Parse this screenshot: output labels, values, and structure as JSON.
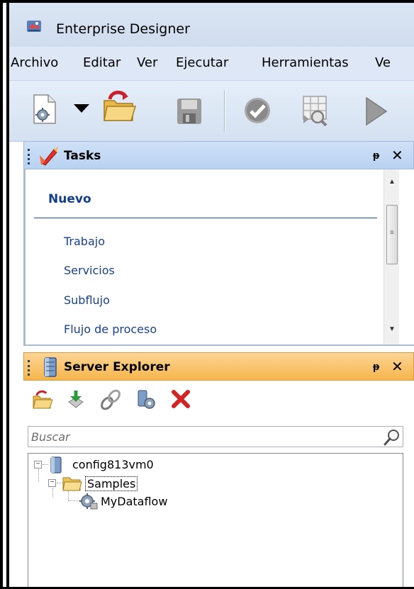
{
  "window": {
    "title": "Enterprise Designer"
  },
  "menu": {
    "items": [
      "Archivo",
      "Editar",
      "Ver",
      "Ejecutar",
      "Herramientas",
      "Ve"
    ]
  },
  "toolbar": {
    "buttons": [
      "new-icon",
      "dropdown-arrow-icon",
      "open-folder-icon",
      "save-icon",
      "validate-icon",
      "inspect-grid-icon",
      "run-icon"
    ]
  },
  "tasks": {
    "title": "Tasks",
    "pin_label": "ᵽ",
    "close_label": "✕",
    "section": "Nuevo",
    "links": [
      "Trabajo",
      "Servicios",
      "Subflujo",
      "Flujo de proceso"
    ]
  },
  "server_explorer": {
    "title": "Server Explorer",
    "pin_label": "ᵽ",
    "close_label": "✕",
    "search_placeholder": "Buscar",
    "tree": {
      "server": "config813vm0",
      "folder": "Samples",
      "item": "MyDataflow"
    }
  },
  "colors": {
    "tasks_header": "#bcd3f1",
    "server_header": "#f8c164",
    "link": "#18418e",
    "section": "#123e8a"
  }
}
